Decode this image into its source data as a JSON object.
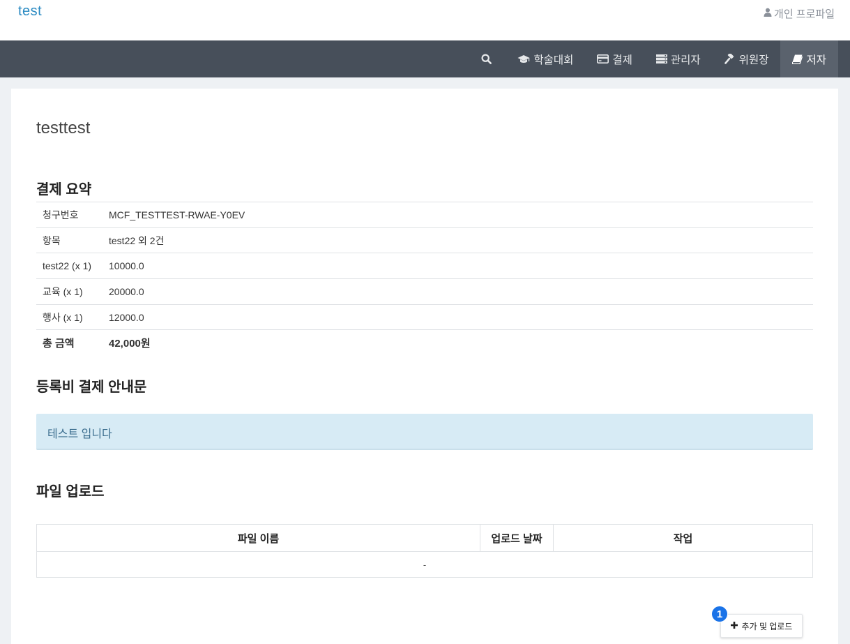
{
  "header": {
    "brand": "test",
    "profile_label": "개인 프로파일",
    "profile_icon": "user-icon"
  },
  "nav": {
    "search_icon": "search-icon",
    "items": [
      {
        "label": "학술대회",
        "icon": "graduation-cap-icon"
      },
      {
        "label": "결제",
        "icon": "credit-card-icon"
      },
      {
        "label": "관리자",
        "icon": "server-icon"
      },
      {
        "label": "위원장",
        "icon": "gavel-icon"
      },
      {
        "label": "저자",
        "icon": "book-icon",
        "active": true
      }
    ]
  },
  "page": {
    "title": "testtest"
  },
  "summary": {
    "title": "결제 요약",
    "rows": [
      {
        "key": "청구번호",
        "value": "MCF_TESTTEST-RWAE-Y0EV"
      },
      {
        "key": "항목",
        "value": "test22 외 2건"
      },
      {
        "key": "test22 (x 1)",
        "value": "10000.0"
      },
      {
        "key": "교육 (x 1)",
        "value": "20000.0"
      },
      {
        "key": "행사 (x 1)",
        "value": "12000.0"
      },
      {
        "key": "총 금액",
        "value": "42,000원"
      }
    ]
  },
  "notice": {
    "title": "등록비 결제 안내문",
    "text": "테스트 입니다"
  },
  "files": {
    "title": "파일 업로드",
    "columns": [
      "파일 이름",
      "업로드 날짜",
      "작업"
    ],
    "empty_text": "-",
    "add_button": "추가 및 업로드",
    "badge": "1"
  },
  "colors": {
    "navbar": "#474f5a",
    "brand": "#2a8ac2",
    "notice_bg": "#d7ebf5",
    "badge": "#1a73e8"
  }
}
